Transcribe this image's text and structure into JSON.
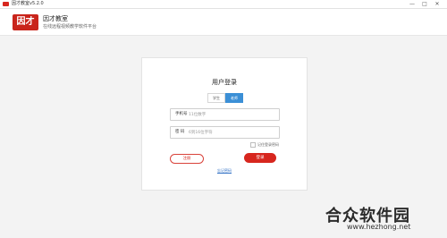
{
  "window": {
    "title": "因才教室v5.2.0",
    "minimize": "—",
    "maximize": "□",
    "close": "✕"
  },
  "header": {
    "logo_text": "因才",
    "brand": "因才教室",
    "tagline": "在线远程视频教学软件平台"
  },
  "login": {
    "title": "用户登录",
    "tabs": [
      {
        "label": "学生",
        "active": false
      },
      {
        "label": "老师",
        "active": true
      }
    ],
    "phone": {
      "label": "手机号",
      "placeholder": "11位数字"
    },
    "password": {
      "label": "密 码",
      "placeholder": "6到16位字符"
    },
    "remember_label": "记住登录密码",
    "register_label": "注册",
    "login_label": "登录",
    "forgot_label": "忘记密码"
  },
  "watermark": {
    "text": "合众软件园",
    "url": "www.hezhong.net"
  },
  "colors": {
    "brand_red": "#d7261e",
    "tab_active": "#3b8fd6",
    "link": "#2f6fc4"
  }
}
